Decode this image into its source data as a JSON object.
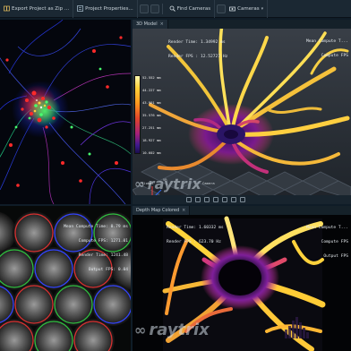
{
  "toolbar": {
    "export_label": "Export Project as Zip ...",
    "project_props_label": "Project Properties...",
    "find_cameras_label": "Find Cameras",
    "cameras_label": "Cameras"
  },
  "panels": {
    "model3d": {
      "tab_label": "3D Model",
      "stats": [
        "Mean Compute T...",
        "Compute FPS",
        "Render Time: 1.34992 ms",
        "Render FPS : 12.52727 Hz"
      ],
      "scale_labels": [
        "52.552 mm",
        "44.227 mm",
        "43.901 mm",
        "35.576 mm",
        "27.251 mm",
        "18.927 mm",
        "10.602 mm"
      ],
      "axis_labels": {
        "global": "Global",
        "vr": "VR",
        "cam": "Camera"
      }
    },
    "raw": {
      "stats": [
        "Mean Compute Time: 0.79 ms",
        "Compute FPS: 1271.01",
        "Render Time: 1241.48",
        "Output FPS: 0.04"
      ]
    },
    "depth": {
      "tab_label": "Depth Map Colored",
      "stats": [
        "Render Time: 1.60332 ms",
        "Render FPS : 623.70 Hz",
        "Mean Compute T...",
        "Compute FPS",
        "Output FPS"
      ]
    }
  },
  "watermark": {
    "brand": "raytrix"
  },
  "colors": {
    "toolbar_bg": "#1b2833",
    "panel_tab": "#1f2c37",
    "accent_orange": "#ff9a1e",
    "accent_magenta": "#a4207a"
  }
}
